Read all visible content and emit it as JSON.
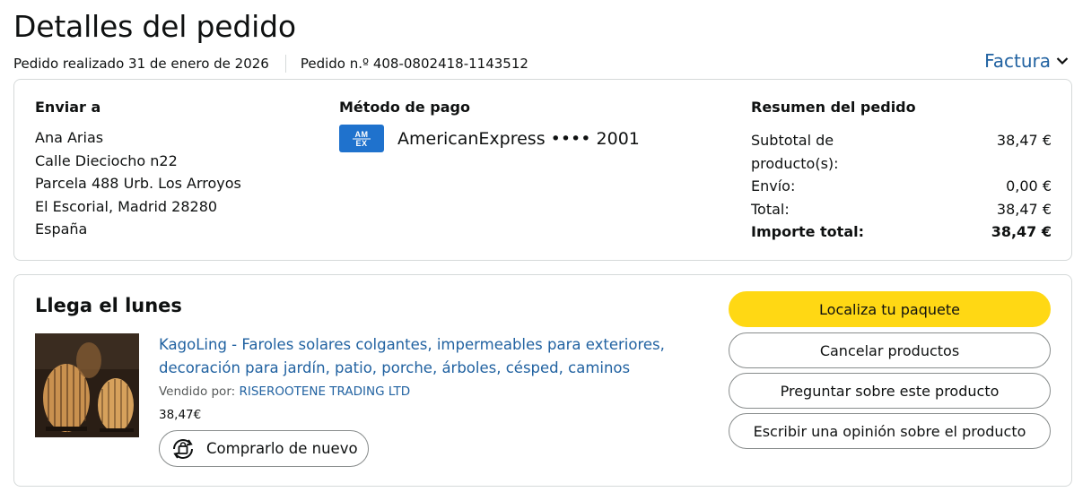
{
  "header": {
    "title": "Detalles del pedido",
    "order_date": "Pedido realizado 31 de enero de 2026",
    "order_number": "Pedido n.º 408-0802418-1143512",
    "invoice_label": "Factura"
  },
  "shipping": {
    "title": "Enviar a",
    "lines": [
      "Ana Arias",
      "Calle Dieciocho n22",
      "Parcela 488 Urb. Los Arroyos",
      "El Escorial, Madrid 28280",
      "España"
    ]
  },
  "payment": {
    "title": "Método de pago",
    "card_logo_text": "AM EX",
    "card_text": "AmericanExpress •••• 2001"
  },
  "summary": {
    "title": "Resumen del pedido",
    "rows": [
      {
        "label": "Subtotal de producto(s):",
        "value": "38,47 €"
      },
      {
        "label": "Envío:",
        "value": "0,00 €"
      },
      {
        "label": "Total:",
        "value": "38,47 €"
      },
      {
        "label": "Importe total:",
        "value": "38,47 €"
      }
    ]
  },
  "shipment": {
    "arrival": "Llega el lunes",
    "product_title": "KagoLing - Faroles solares colgantes, impermeables para exteriores, decoración para jardín, patio, porche, árboles, césped, caminos",
    "sold_by_label": "Vendido por:",
    "seller": "RISEROOTENE TRADING LTD",
    "price": "38,47€",
    "buy_again": "Comprarlo de nuevo"
  },
  "actions": {
    "track": "Localiza tu paquete",
    "cancel": "Cancelar productos",
    "ask": "Preguntar sobre este producto",
    "review": "Escribir una opinión sobre el producto"
  },
  "colors": {
    "link": "#2162a1",
    "primary_button": "#ffd814",
    "amex": "#1f72cd"
  }
}
